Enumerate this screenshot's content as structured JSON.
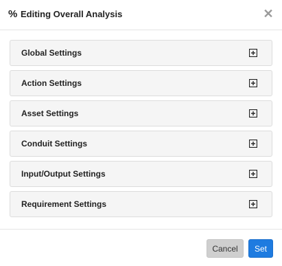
{
  "header": {
    "icon_glyph": "%",
    "icon_name": "percent-icon",
    "title": "Editing Overall Analysis",
    "close_glyph": "✕"
  },
  "panels": [
    {
      "label": "Global Settings",
      "icon": "plus-square-icon"
    },
    {
      "label": "Action Settings",
      "icon": "plus-square-icon"
    },
    {
      "label": "Asset Settings",
      "icon": "plus-square-icon"
    },
    {
      "label": "Conduit Settings",
      "icon": "plus-square-icon"
    },
    {
      "label": "Input/Output Settings",
      "icon": "plus-square-icon"
    },
    {
      "label": "Requirement Settings",
      "icon": "plus-square-icon"
    }
  ],
  "footer": {
    "cancel_label": "Cancel",
    "set_label": "Set"
  },
  "colors": {
    "primary": "#1e7be0",
    "cancel_bg": "#cfcfcf",
    "panel_bg": "#f5f5f5"
  }
}
